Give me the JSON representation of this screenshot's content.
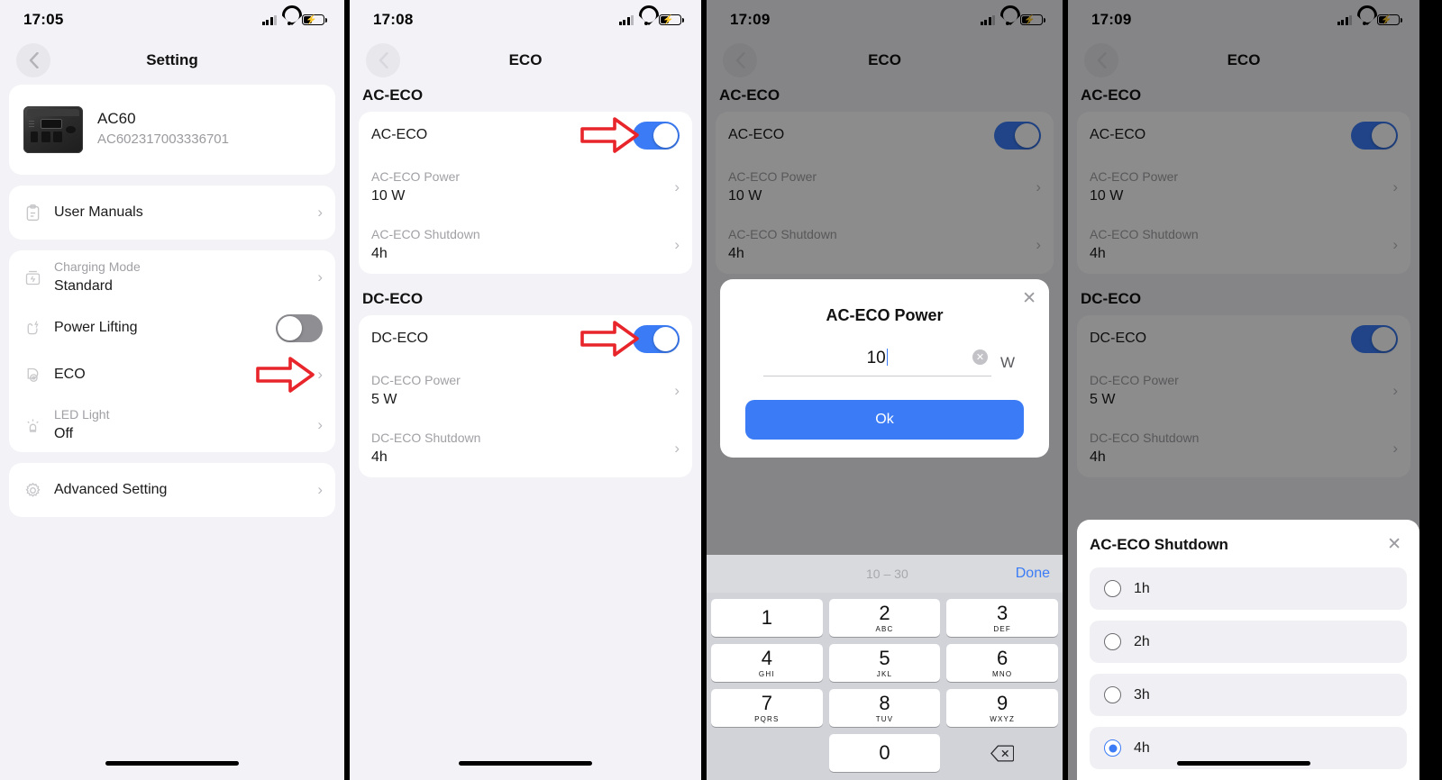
{
  "panels": [
    {
      "status": {
        "time": "17:05"
      },
      "nav": {
        "title": "Setting",
        "back_icon": "chevron-left-icon"
      },
      "device": {
        "name": "AC60",
        "serial": "AC602317003336701"
      },
      "groups": [
        {
          "items": [
            {
              "icon": "clipboard-icon",
              "label": "User Manuals",
              "type": "link"
            }
          ]
        },
        {
          "items": [
            {
              "icon": "battery-charge-icon",
              "label": "Charging Mode",
              "value": "Standard",
              "type": "link"
            },
            {
              "icon": "power-lifting-icon",
              "label": "Power Lifting",
              "type": "toggle",
              "state": "off"
            },
            {
              "icon": "eco-icon",
              "label": "ECO",
              "type": "link",
              "annotated": true
            },
            {
              "icon": "led-light-icon",
              "label": "LED Light",
              "value": "Off",
              "type": "link"
            }
          ]
        },
        {
          "items": [
            {
              "icon": "gear-icon",
              "label": "Advanced Setting",
              "type": "link"
            }
          ]
        }
      ]
    },
    {
      "status": {
        "time": "17:08"
      },
      "nav": {
        "title": "ECO",
        "back_icon": "chevron-left-icon"
      },
      "sections": [
        {
          "title": "AC-ECO",
          "items": [
            {
              "label": "AC-ECO",
              "type": "toggle",
              "state": "on",
              "annotated": true
            },
            {
              "label": "AC-ECO Power",
              "value": "10 W",
              "type": "link"
            },
            {
              "label": "AC-ECO Shutdown",
              "value": "4h",
              "type": "link"
            }
          ]
        },
        {
          "title": "DC-ECO",
          "items": [
            {
              "label": "DC-ECO",
              "type": "toggle",
              "state": "on",
              "annotated": true
            },
            {
              "label": "DC-ECO Power",
              "value": "5 W",
              "type": "link"
            },
            {
              "label": "DC-ECO Shutdown",
              "value": "4h",
              "type": "link"
            }
          ]
        }
      ]
    },
    {
      "status": {
        "time": "17:09"
      },
      "nav": {
        "title": "ECO",
        "back_icon": "chevron-left-icon"
      },
      "sections": [
        {
          "title": "AC-ECO",
          "items": [
            {
              "label": "AC-ECO",
              "type": "toggle",
              "state": "on"
            },
            {
              "label": "AC-ECO Power",
              "value": "10 W",
              "type": "link"
            },
            {
              "label": "AC-ECO Shutdown",
              "value": "4h",
              "type": "link"
            }
          ]
        }
      ],
      "modal": {
        "title": "AC-ECO Power",
        "input_value": "10",
        "unit": "W",
        "clear_icon": "clear-circle-icon",
        "close_icon": "close-icon",
        "ok_label": "Ok"
      },
      "keyboard": {
        "hint": "10 – 30",
        "done_label": "Done",
        "keys": [
          {
            "num": "1",
            "sub": ""
          },
          {
            "num": "2",
            "sub": "ABC"
          },
          {
            "num": "3",
            "sub": "DEF"
          },
          {
            "num": "4",
            "sub": "GHI"
          },
          {
            "num": "5",
            "sub": "JKL"
          },
          {
            "num": "6",
            "sub": "MNO"
          },
          {
            "num": "7",
            "sub": "PQRS"
          },
          {
            "num": "8",
            "sub": "TUV"
          },
          {
            "num": "9",
            "sub": "WXYZ"
          },
          {
            "num": "0",
            "sub": ""
          }
        ],
        "backspace_icon": "backspace-icon"
      }
    },
    {
      "status": {
        "time": "17:09"
      },
      "nav": {
        "title": "ECO",
        "back_icon": "chevron-left-icon"
      },
      "sections": [
        {
          "title": "AC-ECO",
          "items": [
            {
              "label": "AC-ECO",
              "type": "toggle",
              "state": "on"
            },
            {
              "label": "AC-ECO Power",
              "value": "10 W",
              "type": "link"
            },
            {
              "label": "AC-ECO Shutdown",
              "value": "4h",
              "type": "link"
            }
          ]
        },
        {
          "title": "DC-ECO",
          "items": [
            {
              "label": "DC-ECO",
              "type": "toggle",
              "state": "on"
            },
            {
              "label": "DC-ECO Power",
              "value": "5 W",
              "type": "link"
            },
            {
              "label": "DC-ECO Shutdown",
              "value": "4h",
              "type": "link"
            }
          ]
        }
      ],
      "sheet": {
        "title": "AC-ECO Shutdown",
        "close_icon": "close-icon",
        "options": [
          {
            "label": "1h",
            "selected": false
          },
          {
            "label": "2h",
            "selected": false
          },
          {
            "label": "3h",
            "selected": false
          },
          {
            "label": "4h",
            "selected": true
          }
        ]
      }
    }
  ],
  "colors": {
    "accent_blue": "#3b7cf6",
    "annotation_red": "#e8252a",
    "page_bg": "#f2f2f7",
    "card_bg": "#ffffff",
    "muted_text": "#a0a0a5"
  }
}
